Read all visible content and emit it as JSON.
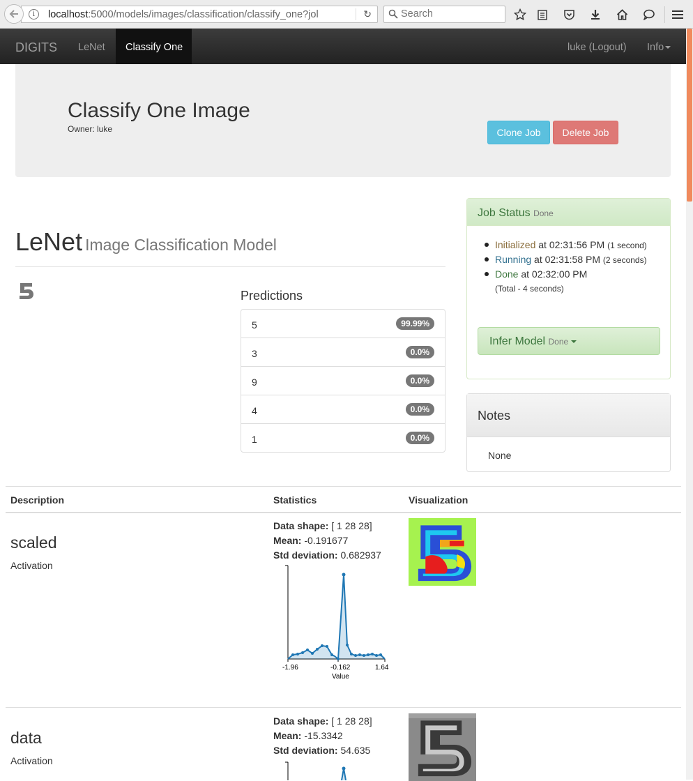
{
  "browser": {
    "url_host": "localhost",
    "url_rest": ":5000/models/images/classification/classify_one?jol",
    "search_placeholder": "Search"
  },
  "navbar": {
    "brand": "DIGITS",
    "items": [
      "LeNet",
      "Classify One"
    ],
    "user": "luke (Logout)",
    "info": "Info"
  },
  "header": {
    "title": "Classify One Image",
    "owner": "Owner: luke",
    "clone_label": "Clone Job",
    "delete_label": "Delete Job"
  },
  "model": {
    "name": "LeNet",
    "type": "Image Classification Model"
  },
  "predictions": {
    "title": "Predictions",
    "items": [
      {
        "label": "5",
        "value": "99.99%"
      },
      {
        "label": "3",
        "value": "0.0%"
      },
      {
        "label": "9",
        "value": "0.0%"
      },
      {
        "label": "4",
        "value": "0.0%"
      },
      {
        "label": "1",
        "value": "0.0%"
      }
    ]
  },
  "job_status": {
    "title": "Job Status",
    "state": "Done",
    "steps": [
      {
        "name": "Initialized",
        "time": "at 02:31:56 PM",
        "duration": "(1 second)"
      },
      {
        "name": "Running",
        "time": "at 02:31:58 PM",
        "duration": "(2 seconds)"
      },
      {
        "name": "Done",
        "time": "at 02:32:00 PM",
        "duration": "(Total - 4 seconds)"
      }
    ],
    "infer_label": "Infer Model",
    "infer_state": "Done"
  },
  "notes": {
    "title": "Notes",
    "body": "None"
  },
  "table": {
    "headers": [
      "Description",
      "Statistics",
      "Visualization"
    ],
    "rows": [
      {
        "name": "scaled",
        "type": "Activation",
        "shape_label": "Data shape:",
        "shape": "[ 1 28 28]",
        "mean_label": "Mean:",
        "mean": "-0.191677",
        "std_label": "Std deviation:",
        "std": "0.682937",
        "hist_ticks": [
          "-1.96",
          "-0.162",
          "1.64"
        ],
        "hist_xlabel": "Value"
      },
      {
        "name": "data",
        "type": "Activation",
        "shape_label": "Data shape:",
        "shape": "[ 1 28 28]",
        "mean_label": "Mean:",
        "mean": "-15.3342",
        "std_label": "Std deviation:",
        "std": "54.635"
      }
    ]
  },
  "colors": {
    "accent_info": "#5bc0de",
    "accent_danger": "#d9534f",
    "success_text": "#3c763d",
    "hist_line": "#1f77b4",
    "scrollbar_thumb": "#f08a5d"
  }
}
